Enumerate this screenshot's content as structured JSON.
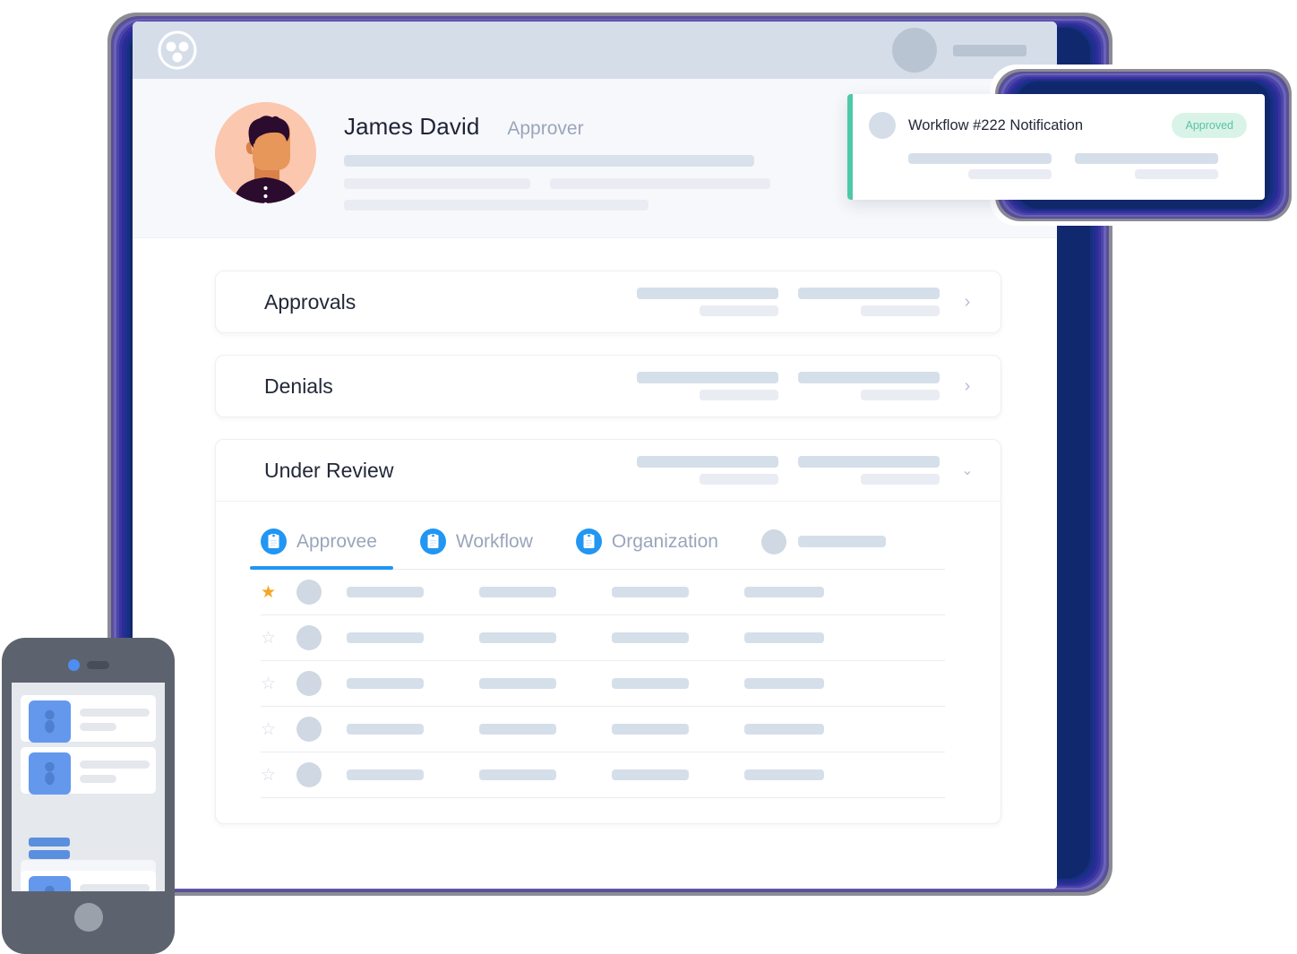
{
  "window": {
    "topbar": {
      "logo_icon": "three-dot-circle-logo",
      "user_avatar": "user-avatar-placeholder",
      "user_name_placeholder": ""
    }
  },
  "profile": {
    "avatar_icon": "user-illustration-avatar",
    "name": "James David",
    "role": "Approver",
    "detail_placeholders": 4
  },
  "cards": [
    {
      "id": "approvals",
      "title": "Approvals",
      "expanded": false,
      "chevron_icon": "chevron-right-icon",
      "chevron_glyph": "›"
    },
    {
      "id": "denials",
      "title": "Denials",
      "expanded": false,
      "chevron_icon": "chevron-right-icon",
      "chevron_glyph": "›"
    },
    {
      "id": "under-review",
      "title": "Under Review",
      "expanded": true,
      "chevron_icon": "chevron-down-icon",
      "chevron_glyph": "⌄"
    }
  ],
  "under_review": {
    "tabs": [
      {
        "label": "Approvee",
        "icon": "document-icon",
        "active": true
      },
      {
        "label": "Workflow",
        "icon": "document-icon",
        "active": false
      },
      {
        "label": "Organization",
        "icon": "document-icon",
        "active": false
      }
    ],
    "tab_extra": {
      "avatar_icon": "avatar-placeholder",
      "bar_placeholder": ""
    },
    "rows": [
      {
        "starred": true,
        "star_glyph": "★"
      },
      {
        "starred": false,
        "star_glyph": "☆"
      },
      {
        "starred": false,
        "star_glyph": "☆"
      },
      {
        "starred": false,
        "star_glyph": "☆"
      },
      {
        "starred": false,
        "star_glyph": "☆"
      }
    ]
  },
  "notification": {
    "avatar_icon": "notification-avatar",
    "title": "Workflow #222 Notification",
    "status_badge": "Approved",
    "accent_color": "#4ec9a8",
    "badge_bg": "#d9f3e9",
    "badge_text_color": "#5bc3a3"
  },
  "phone": {
    "camera_icon": "front-camera-dot",
    "speaker_icon": "earpiece-speaker",
    "home_button_icon": "home-button",
    "list_items": 3
  },
  "colors": {
    "topbar_bg": "#d5dde9",
    "profile_bg": "#f7f8fb",
    "accent_blue": "#2196f3",
    "star_gold": "#f5a623",
    "frame_outer": "#8c8c94",
    "frame_deep": "#10286d"
  }
}
